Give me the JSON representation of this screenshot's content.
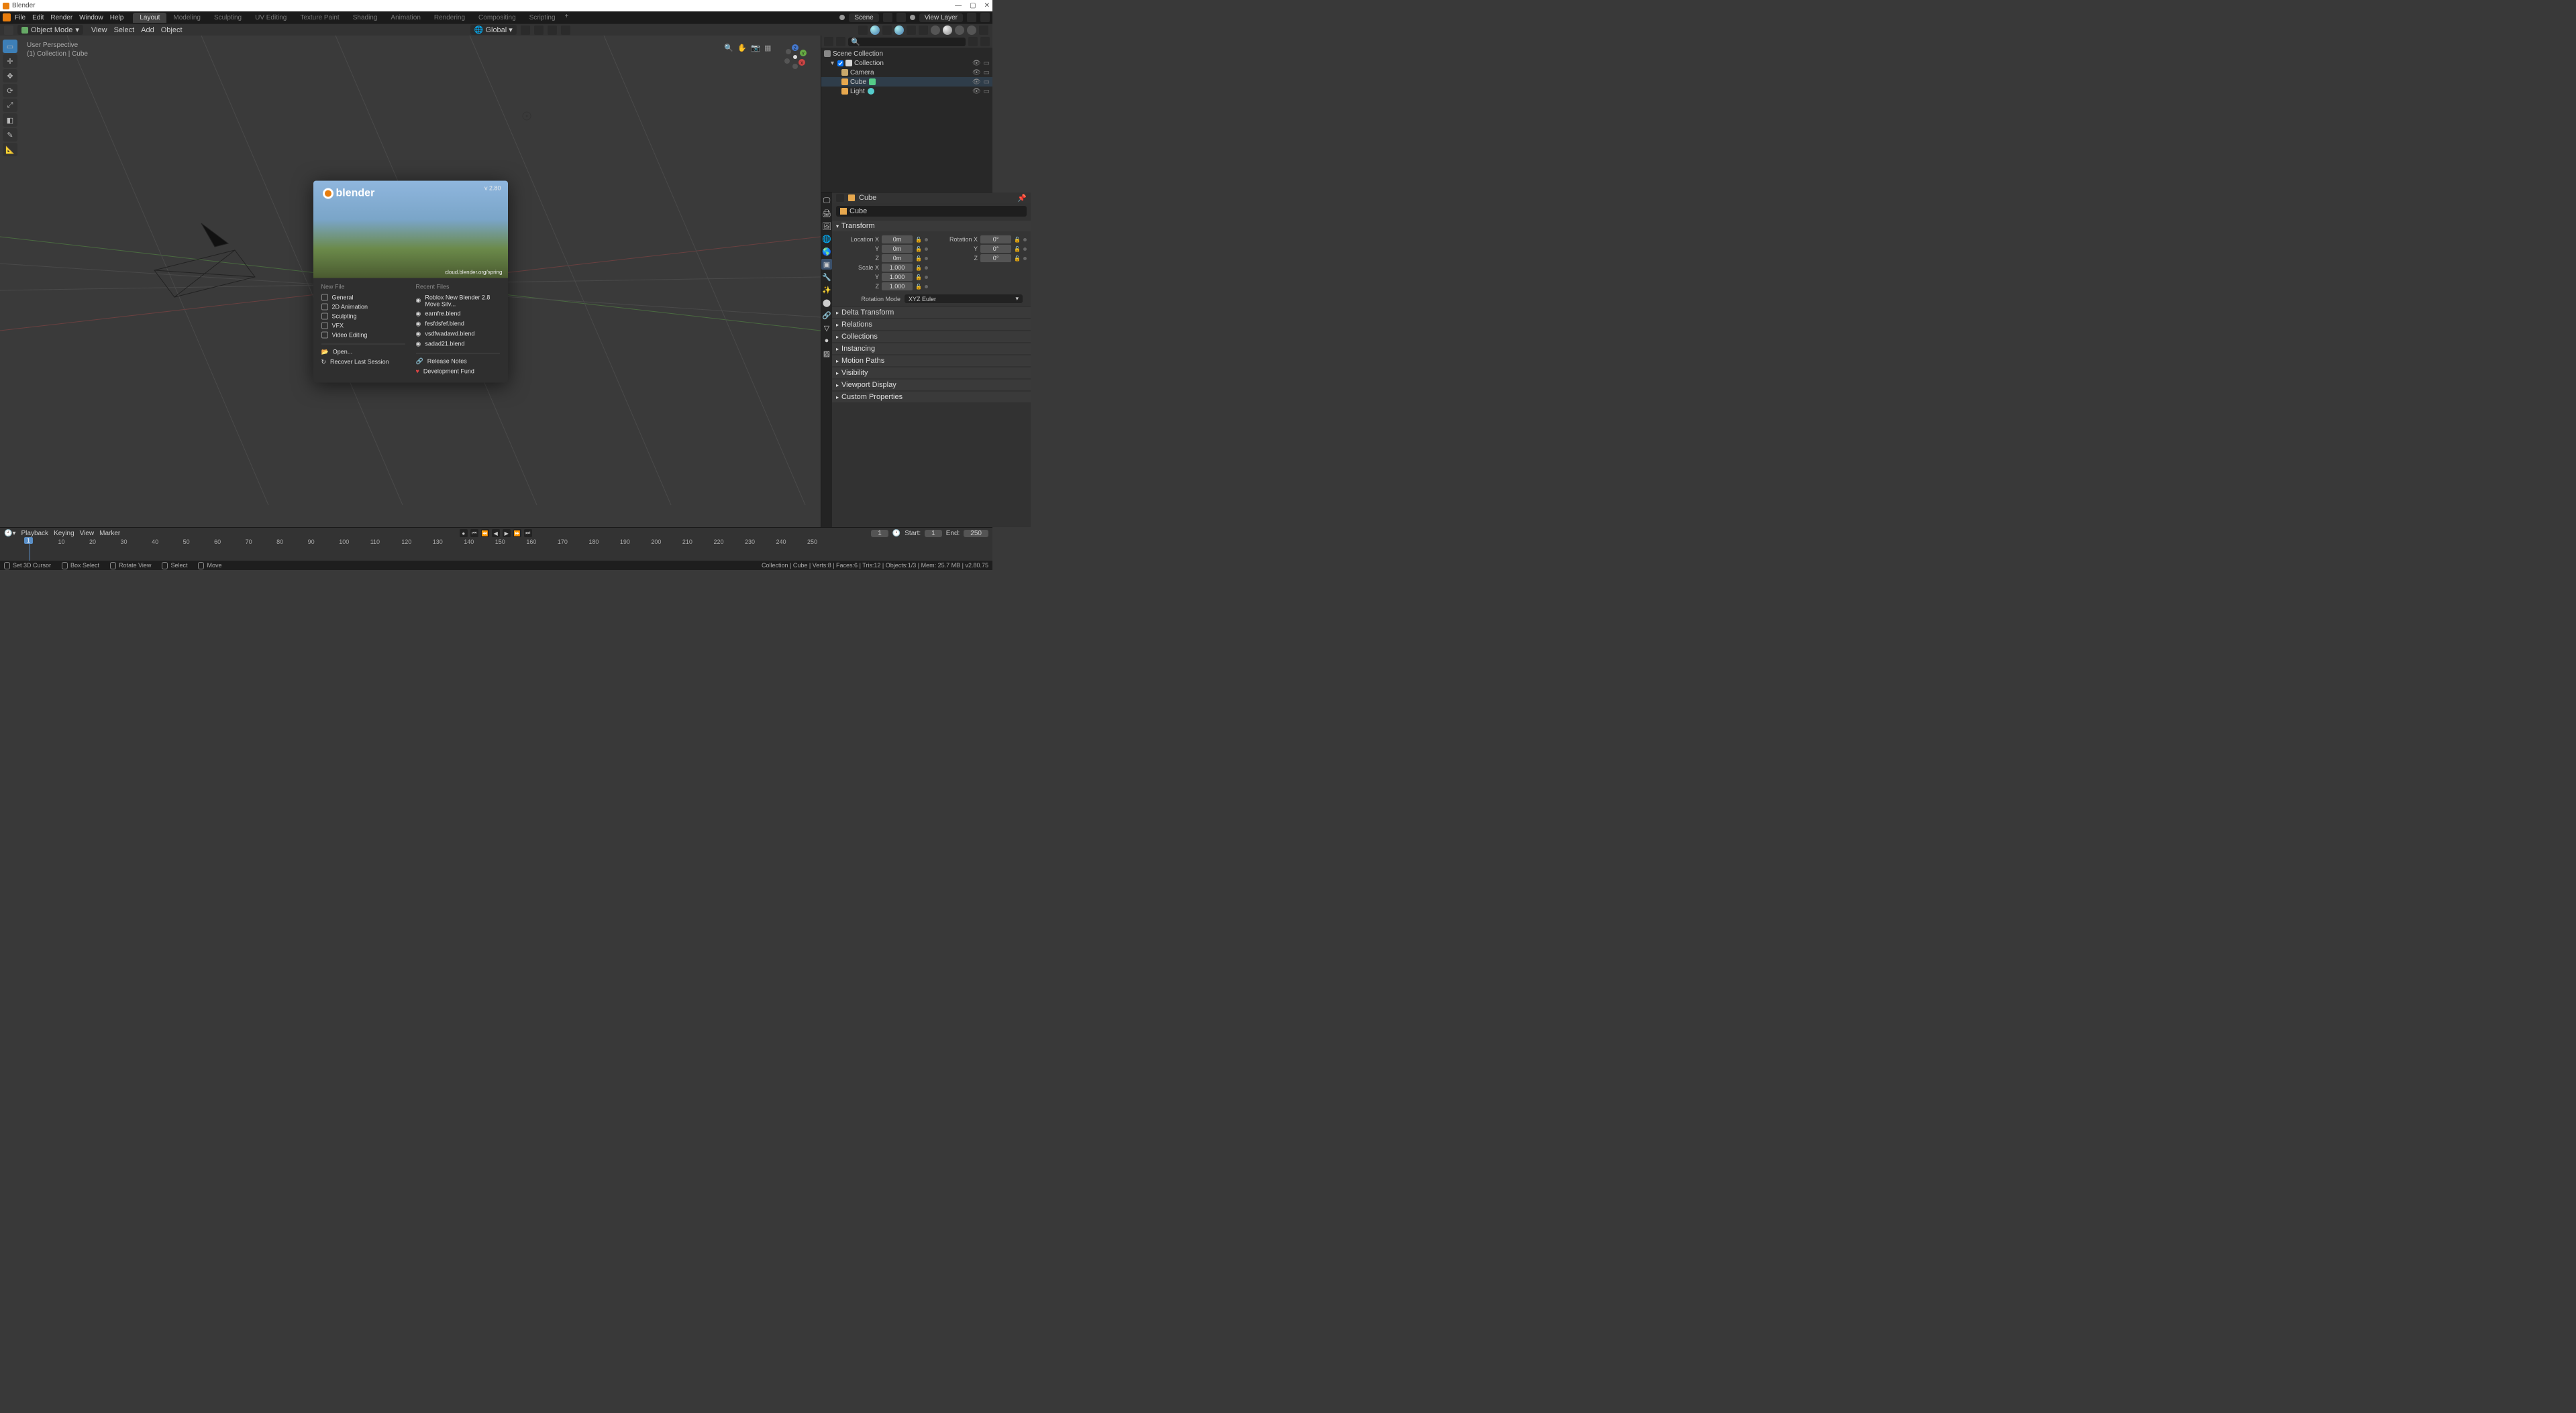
{
  "window": {
    "title": "Blender"
  },
  "menus": [
    "File",
    "Edit",
    "Render",
    "Window",
    "Help"
  ],
  "tabs": [
    "Layout",
    "Modeling",
    "Sculpting",
    "UV Editing",
    "Texture Paint",
    "Shading",
    "Animation",
    "Rendering",
    "Compositing",
    "Scripting"
  ],
  "active_tab": "Layout",
  "scene": {
    "label": "Scene"
  },
  "viewlayer": {
    "label": "View Layer"
  },
  "viewport_header": {
    "mode": "Object Mode",
    "menus": [
      "View",
      "Select",
      "Add",
      "Object"
    ],
    "orientation": "Global"
  },
  "viewport_info": {
    "line1": "User Perspective",
    "line2": "(1) Collection | Cube"
  },
  "outliner": {
    "root": "Scene Collection",
    "collection": "Collection",
    "items": [
      {
        "name": "Camera",
        "type": "camera"
      },
      {
        "name": "Cube",
        "type": "mesh",
        "selected": true
      },
      {
        "name": "Light",
        "type": "light"
      }
    ],
    "search_placeholder": ""
  },
  "properties": {
    "object_name": "Cube",
    "name_field": "Cube",
    "transform": {
      "location": {
        "x": "0m",
        "y": "0m",
        "z": "0m"
      },
      "rotation": {
        "x": "0°",
        "y": "0°",
        "z": "0°"
      },
      "scale": {
        "x": "1.000",
        "y": "1.000",
        "z": "1.000"
      },
      "rotation_mode_label": "Rotation Mode",
      "rotation_mode": "XYZ Euler",
      "labels": {
        "location": "Location",
        "rotation": "Rotation",
        "scale": "Scale"
      }
    },
    "panels": [
      "Transform",
      "Delta Transform",
      "Relations",
      "Collections",
      "Instancing",
      "Motion Paths",
      "Visibility",
      "Viewport Display",
      "Custom Properties"
    ]
  },
  "splash": {
    "app": "blender",
    "version": "v 2.80",
    "url": "cloud.blender.org/spring",
    "new_file_label": "New File",
    "recent_label": "Recent Files",
    "new_file": [
      "General",
      "2D Animation",
      "Sculpting",
      "VFX",
      "Video Editing"
    ],
    "recent": [
      "Roblox New Blender 2.8 Move Silv...",
      "earnfre.blend",
      "fesfdsfef.blend",
      "vsdfwadawd.blend",
      "sadad21.blend"
    ],
    "open": "Open...",
    "recover": "Recover Last Session",
    "release_notes": "Release Notes",
    "dev_fund": "Development Fund"
  },
  "timeline": {
    "menus": [
      "Playback",
      "Keying",
      "View",
      "Marker"
    ],
    "current": 1,
    "start_label": "Start:",
    "start": 1,
    "end_label": "End:",
    "end": 250,
    "tick_start": 0,
    "tick_step": 10,
    "tick_count": 26
  },
  "statusbar": {
    "left": [
      "Set 3D Cursor",
      "Box Select",
      "Rotate View",
      "Select",
      "Move"
    ],
    "right": "Collection | Cube | Verts:8 | Faces:6 | Tris:12 | Objects:1/3 | Mem: 25.7 MB | v2.80.75"
  }
}
